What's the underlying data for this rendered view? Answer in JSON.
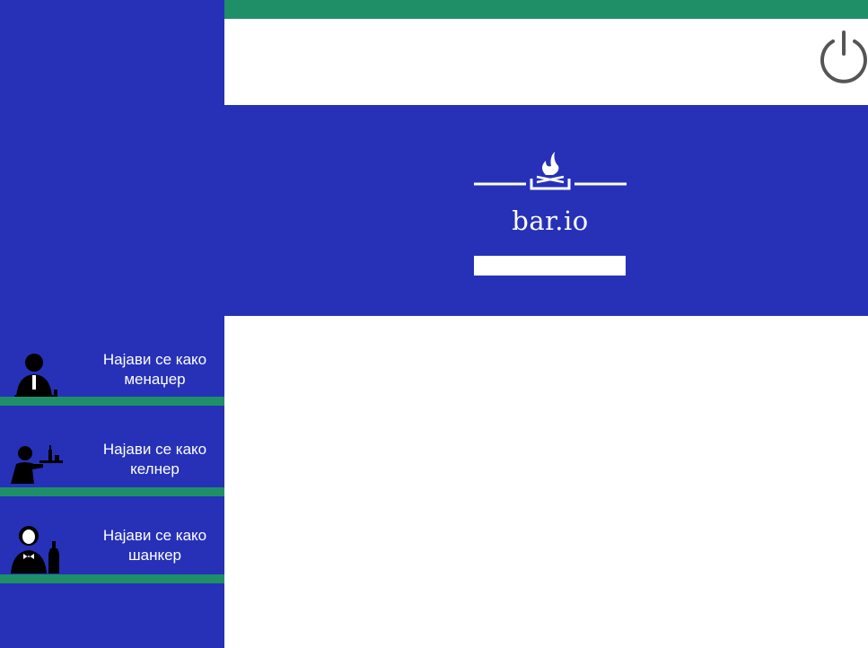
{
  "brand": {
    "name": "bar.io"
  },
  "login_options": [
    {
      "label_line1": "Најави се како",
      "label_line2": "менаџер",
      "icon": "manager-icon"
    },
    {
      "label_line1": "Најави се како",
      "label_line2": "келнер",
      "icon": "waiter-icon"
    },
    {
      "label_line1": "Најави се како",
      "label_line2": "шанкер",
      "icon": "bartender-icon"
    }
  ],
  "colors": {
    "primary": "#2631b8",
    "accent": "#1f8f67",
    "power": "#555555"
  },
  "header": {
    "power_icon": "power-icon"
  }
}
